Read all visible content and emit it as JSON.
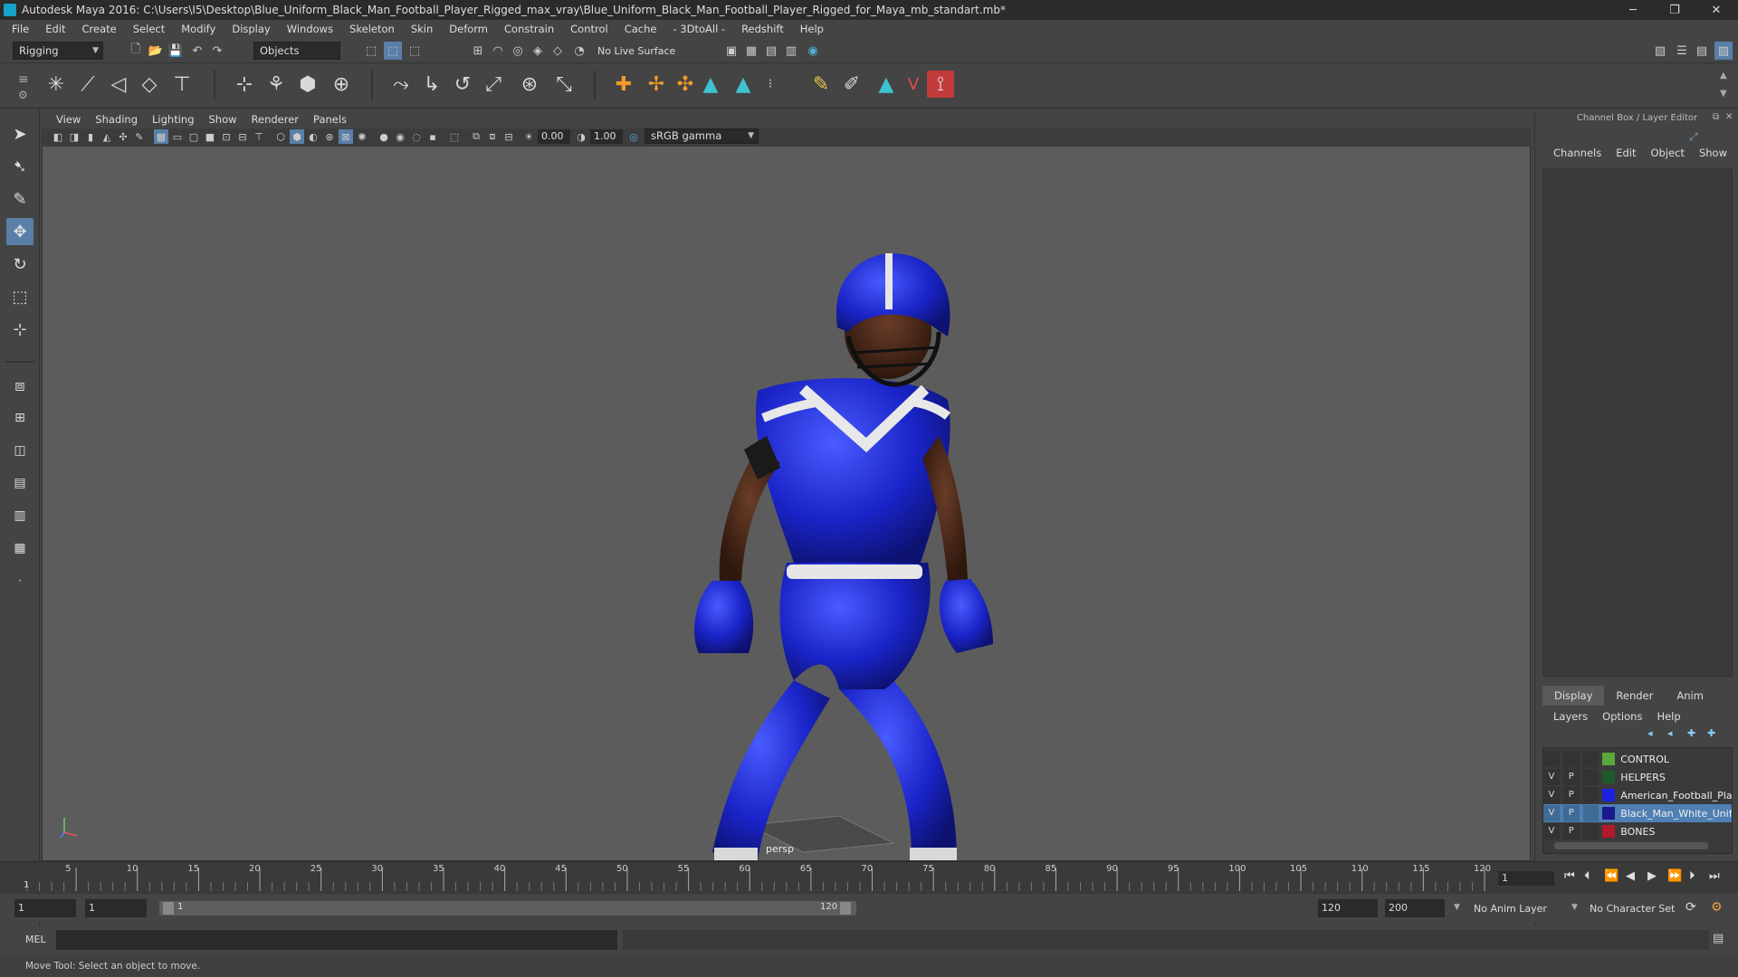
{
  "window": {
    "title": "Autodesk Maya 2016: C:\\Users\\I5\\Desktop\\Blue_Uniform_Black_Man_Football_Player_Rigged_max_vray\\Blue_Uniform_Black_Man_Football_Player_Rigged_for_Maya_mb_standart.mb*",
    "minimize": "─",
    "restore": "❐",
    "close": "✕"
  },
  "menubar": [
    "File",
    "Edit",
    "Create",
    "Select",
    "Modify",
    "Display",
    "Windows",
    "Skeleton",
    "Skin",
    "Deform",
    "Constrain",
    "Control",
    "Cache",
    "- 3DtoAll -",
    "Redshift",
    "Help"
  ],
  "statusline": {
    "mode": "Rigging",
    "select_mode": "Objects",
    "live_surface": "No Live Surface"
  },
  "panel": {
    "menus": [
      "View",
      "Shading",
      "Lighting",
      "Show",
      "Renderer",
      "Panels"
    ],
    "exposure": "0.00",
    "gamma": "1.00",
    "color_space": "sRGB gamma"
  },
  "viewport": {
    "camera": "persp"
  },
  "channel_box": {
    "title": "Channel Box / Layer Editor",
    "menus": [
      "Channels",
      "Edit",
      "Object",
      "Show"
    ]
  },
  "layer_editor": {
    "tabs": [
      "Display",
      "Render",
      "Anim"
    ],
    "active_tab": "Display",
    "menus": [
      "Layers",
      "Options",
      "Help"
    ],
    "layers": [
      {
        "v": "",
        "p": "",
        "color": "#5aa83a",
        "name": "CONTROL"
      },
      {
        "v": "V",
        "p": "P",
        "color": "#1f5a2a",
        "name": "HELPERS"
      },
      {
        "v": "V",
        "p": "P",
        "color": "#1a22e0",
        "name": "American_Football_Pla"
      },
      {
        "v": "V",
        "p": "P",
        "color": "#1a1a8a",
        "name": "Black_Man_White_Uniform_T",
        "selected": true
      },
      {
        "v": "V",
        "p": "P",
        "color": "#b01a2a",
        "name": "BONES"
      }
    ]
  },
  "timeline": {
    "ticks": [
      "5",
      "10",
      "15",
      "20",
      "25",
      "30",
      "35",
      "40",
      "45",
      "50",
      "55",
      "60",
      "65",
      "70",
      "75",
      "80",
      "85",
      "90",
      "95",
      "100",
      "105",
      "110",
      "115",
      "120"
    ],
    "start_marker": "1",
    "current_frame": "1"
  },
  "range": {
    "start": "1",
    "playback_start": "1",
    "slider_start": "1",
    "slider_end": "120",
    "playback_end": "120",
    "end": "200",
    "anim_layer": "No Anim Layer",
    "character_set": "No Character Set"
  },
  "command": {
    "label": "MEL"
  },
  "help": {
    "text": "Move Tool: Select an object to move."
  }
}
